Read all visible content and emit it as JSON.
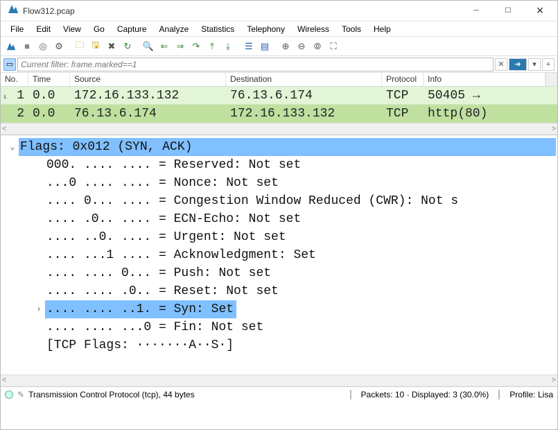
{
  "window": {
    "title": "Flow312.pcap"
  },
  "menu": [
    "File",
    "Edit",
    "View",
    "Go",
    "Capture",
    "Analyze",
    "Statistics",
    "Telephony",
    "Wireless",
    "Tools",
    "Help"
  ],
  "filter": {
    "placeholder": "Current filter: frame.marked==1",
    "clear": "✕",
    "go": "➔",
    "dd": "▾",
    "plus": "+"
  },
  "columns": {
    "no": "No.",
    "time": "Time",
    "src": "Source",
    "dst": "Destination",
    "proto": "Protocol",
    "info": "Info"
  },
  "packets": [
    {
      "no": "1",
      "time": "0.0",
      "src": "172.16.133.132",
      "dst": "76.13.6.174",
      "proto": "TCP",
      "info": "50405 →"
    },
    {
      "no": "2",
      "time": "0.0",
      "src": "76.13.6.174",
      "dst": "172.16.133.132",
      "proto": "TCP",
      "info": "http(80)"
    }
  ],
  "details": {
    "flags_header": "Flags: 0x012 (SYN, ACK)",
    "lines": [
      "000. .... .... = Reserved: Not set",
      "...0 .... .... = Nonce: Not set",
      ".... 0... .... = Congestion Window Reduced (CWR): Not s",
      ".... .0.. .... = ECN-Echo: Not set",
      ".... ..0. .... = Urgent: Not set",
      ".... ...1 .... = Acknowledgment: Set",
      ".... .... 0... = Push: Not set",
      ".... .... .0.. = Reset: Not set"
    ],
    "syn_line": ".... .... ..1. = Syn: Set",
    "fin_line": ".... .... ...0 = Fin: Not set",
    "summary": "[TCP Flags: ·······A··S·]"
  },
  "status": {
    "left": "Transmission Control Protocol (tcp), 44 bytes",
    "mid": "Packets: 10 · Displayed: 3 (30.0%)",
    "right": "Profile: Lisa"
  },
  "scroll": {
    "left": "<",
    "right": ">"
  }
}
